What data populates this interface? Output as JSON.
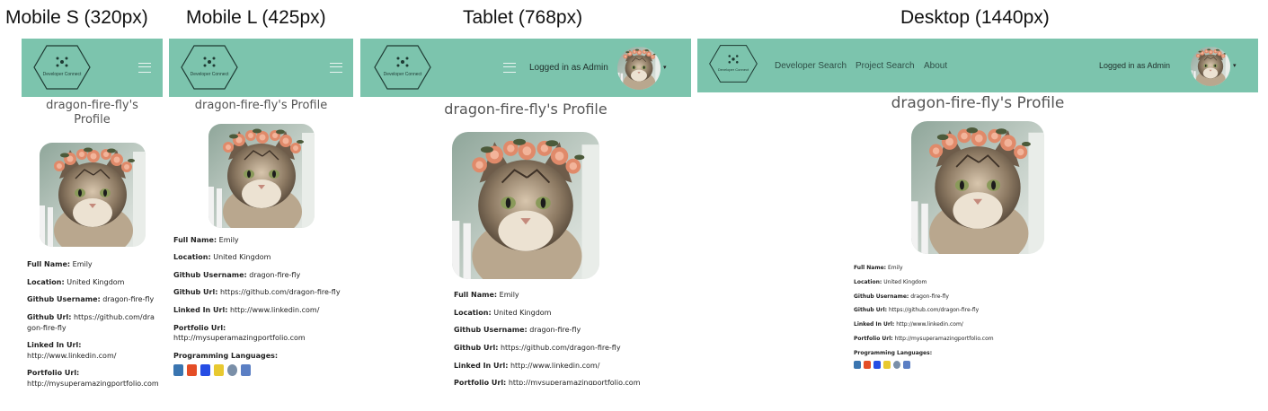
{
  "viewports": [
    {
      "title": "Mobile S (320px)"
    },
    {
      "title": "Mobile L (425px)"
    },
    {
      "title": "Tablet (768px)"
    },
    {
      "title": "Desktop (1440px)"
    }
  ],
  "brand": {
    "logo_text": "Developer Connect"
  },
  "nav": {
    "links": [
      "Developer Search",
      "Project Search",
      "About"
    ],
    "logged_in": "Logged in as Admin",
    "caret": "▾"
  },
  "profile": {
    "title": "dragon-fire-fly's Profile",
    "title_line1": "dragon-fire-fly's",
    "title_line2": "Profile",
    "fields": [
      {
        "label": "Full Name:",
        "value": "Emily"
      },
      {
        "label": "Location:",
        "value": "United Kingdom"
      },
      {
        "label": "Github Username:",
        "value": "dragon-fire-fly"
      },
      {
        "label": "Github Url:",
        "value": "https://github.com/dragon-fire-fly"
      },
      {
        "label": "Linked In Url:",
        "value": "http://www.linkedin.com/"
      },
      {
        "label": "Portfolio Url:",
        "value": "http://mysuperamazingportfolio.com"
      }
    ],
    "languages_label": "Programming Languages:"
  },
  "colors": {
    "nav_bg": "#7cc4ad",
    "title": "#555555"
  },
  "icons": [
    "python-icon",
    "html5-icon",
    "css3-icon",
    "javascript-icon",
    "r-icon",
    "database-icon"
  ]
}
